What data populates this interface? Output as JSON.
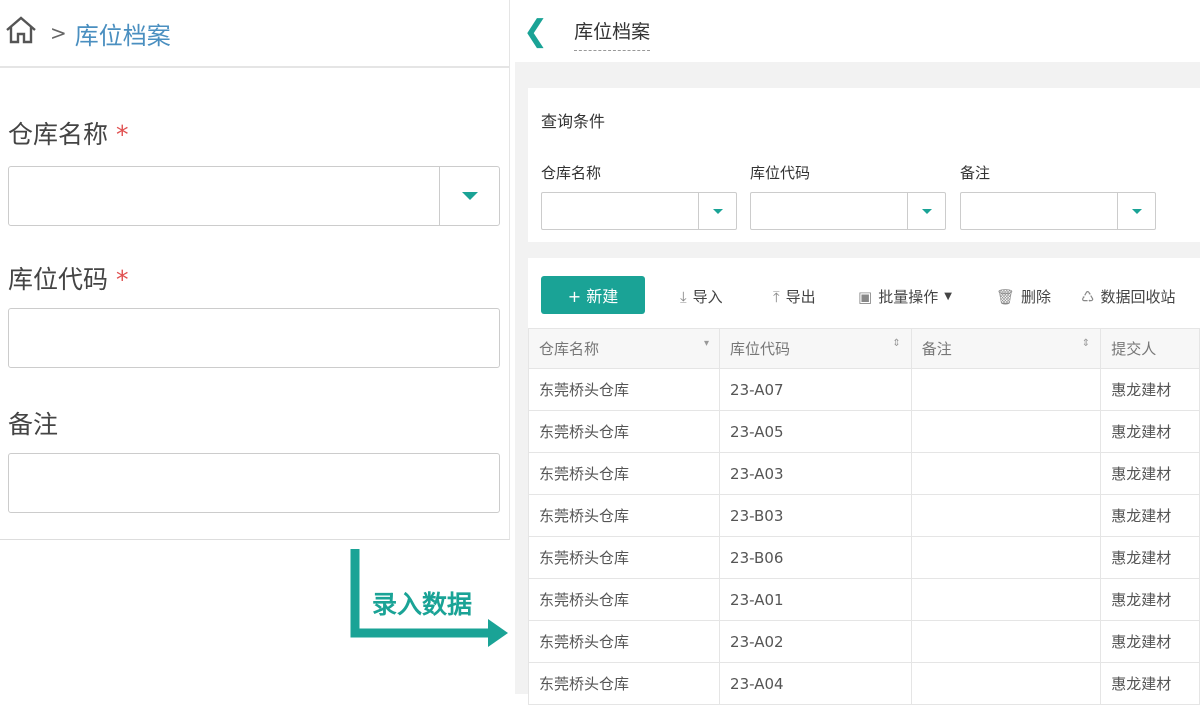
{
  "form": {
    "breadcrumb": "库位档案",
    "fields": [
      {
        "label": "仓库名称",
        "required": "*"
      },
      {
        "label": "库位代码",
        "required": "*"
      },
      {
        "label": "备注"
      }
    ]
  },
  "annotation": "录入数据",
  "page": {
    "title": "库位档案"
  },
  "query": {
    "title": "查询条件",
    "filters": [
      "仓库名称",
      "库位代码",
      "备注"
    ]
  },
  "toolbar": {
    "new": "+ 新建",
    "import": "导入",
    "export": "导出",
    "batch": "批量操作",
    "delete": "删除",
    "recycle": "数据回收站"
  },
  "table": {
    "headers": [
      "仓库名称",
      "库位代码",
      "备注",
      "提交人"
    ],
    "rows": [
      [
        "东莞桥头仓库",
        "23-A07",
        "",
        "惠龙建材"
      ],
      [
        "东莞桥头仓库",
        "23-A05",
        "",
        "惠龙建材"
      ],
      [
        "东莞桥头仓库",
        "23-A03",
        "",
        "惠龙建材"
      ],
      [
        "东莞桥头仓库",
        "23-B03",
        "",
        "惠龙建材"
      ],
      [
        "东莞桥头仓库",
        "23-B06",
        "",
        "惠龙建材"
      ],
      [
        "东莞桥头仓库",
        "23-A01",
        "",
        "惠龙建材"
      ],
      [
        "东莞桥头仓库",
        "23-A02",
        "",
        "惠龙建材"
      ],
      [
        "东莞桥头仓库",
        "23-A04",
        "",
        "惠龙建材"
      ]
    ]
  },
  "colors": {
    "accent": "#1aa396"
  }
}
